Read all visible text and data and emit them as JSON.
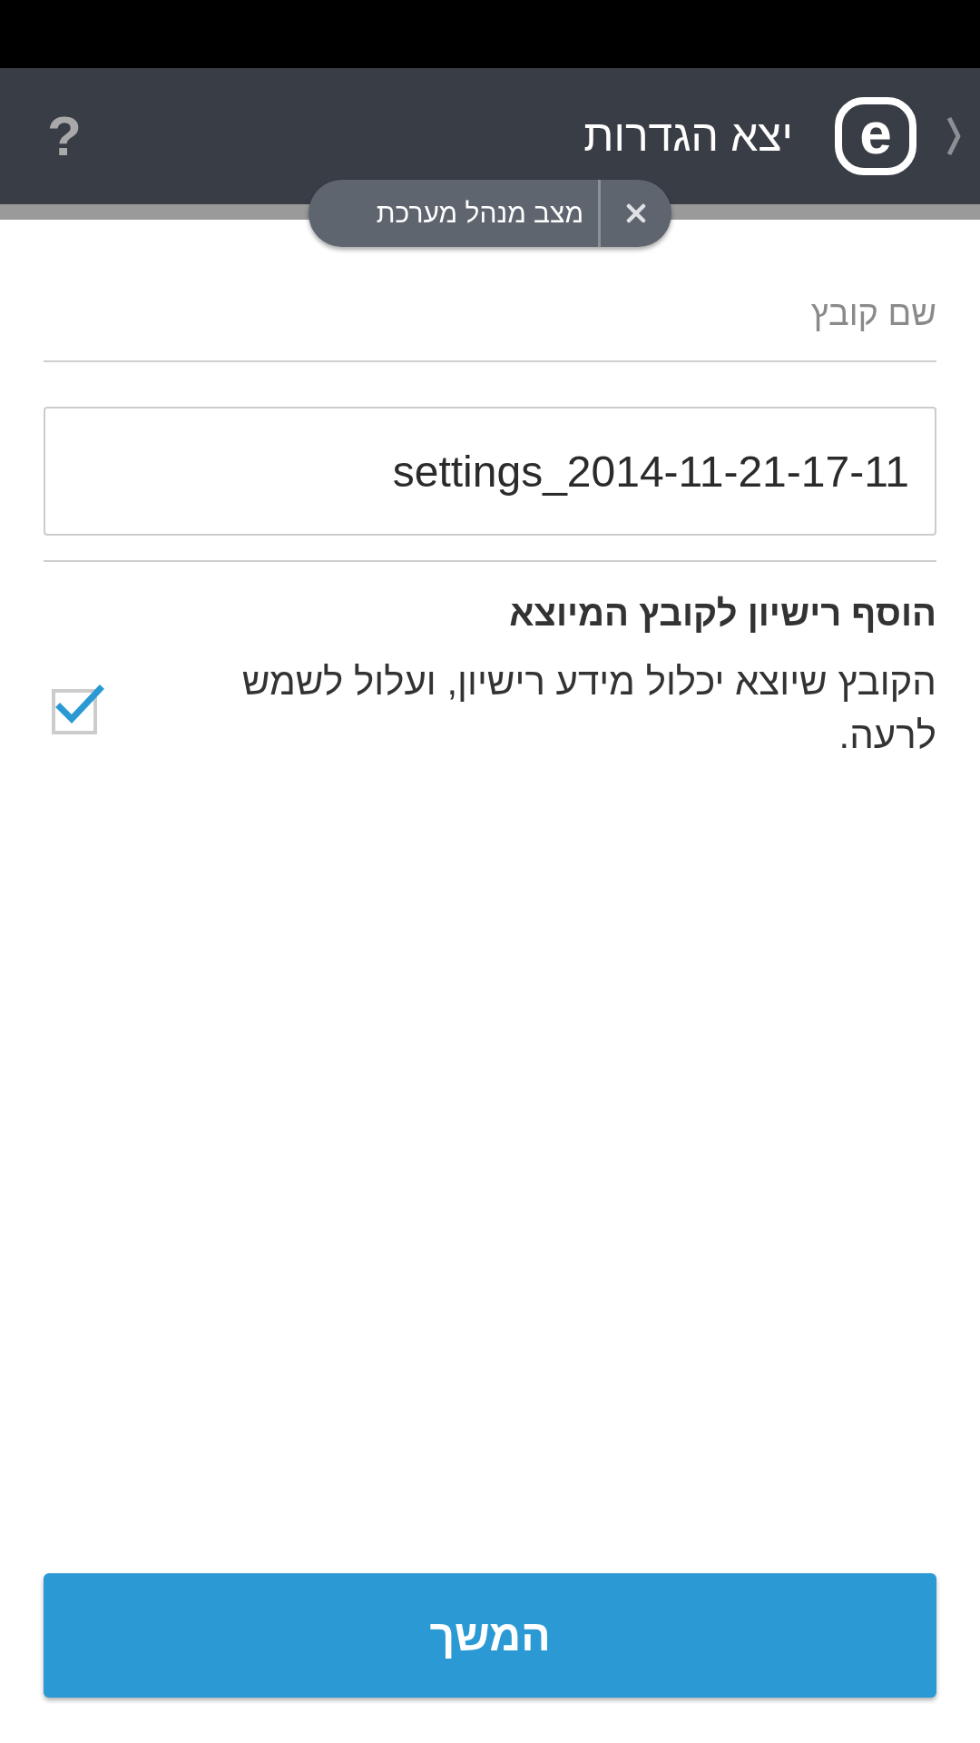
{
  "header": {
    "logo": "e",
    "title": "יצא הגדרות",
    "help": "?"
  },
  "mode_badge": {
    "label": "מצב מנהל מערכת"
  },
  "file_name": {
    "label": "שם קובץ",
    "value": "settings_2014-11-21-17-11"
  },
  "license_option": {
    "title": "הוסף רישיון לקובץ המיוצא",
    "description": "הקובץ שיוצא יכלול מידע רישיון, ועלול לשמש לרעה.",
    "checked": true
  },
  "continue_button": {
    "label": "המשך"
  }
}
